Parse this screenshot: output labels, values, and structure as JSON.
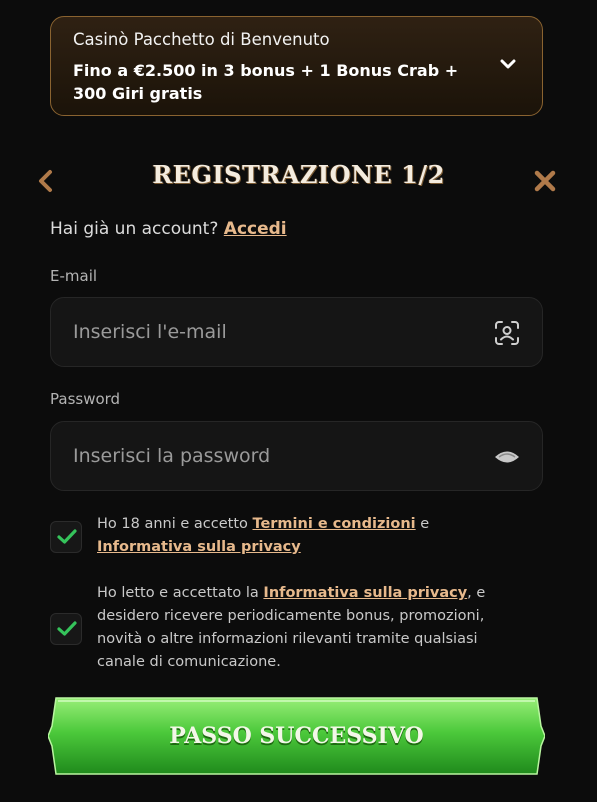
{
  "bonus": {
    "title": "Casinò Pacchetto di Benvenuto",
    "offer": "Fino a €2.500 in 3 bonus + 1 Bonus Crab + 300 Giri gratis",
    "expand_icon": "chevron-down-icon"
  },
  "nav": {
    "back_icon": "chevron-left-icon",
    "close_icon": "close-icon",
    "heading": "REGISTRAZIONE 1/2"
  },
  "login": {
    "prompt": "Hai già un account?",
    "link": "Accedi"
  },
  "email": {
    "label": "E-mail",
    "placeholder": "Inserisci l'e-mail",
    "value": "",
    "icon": "face-scan-icon"
  },
  "password": {
    "label": "Password",
    "placeholder": "Inserisci la password",
    "value": "",
    "icon": "eye-icon"
  },
  "consent_terms": {
    "checked": true,
    "text_1": "Ho 18 anni e accetto",
    "link_1": "Termini e condizioni",
    "text_2": "e",
    "link_2": "Informativa sulla privacy"
  },
  "consent_marketing": {
    "checked": true,
    "text_1": "Ho letto e accettato la",
    "link_1": "Informativa sulla privacy",
    "text_2": ", e desidero ricevere periodicamente bonus, promozioni, novità o altre informazioni rilevanti tramite qualsiasi canale di comunicazione."
  },
  "cta": {
    "label": "PASSO SUCCESSIVO"
  },
  "colors": {
    "background": "#0c0c0c",
    "accent": "#e7b98c",
    "bonus_border": "#8a6330",
    "check": "#35c35b",
    "cta_green": "#3fbe35"
  }
}
